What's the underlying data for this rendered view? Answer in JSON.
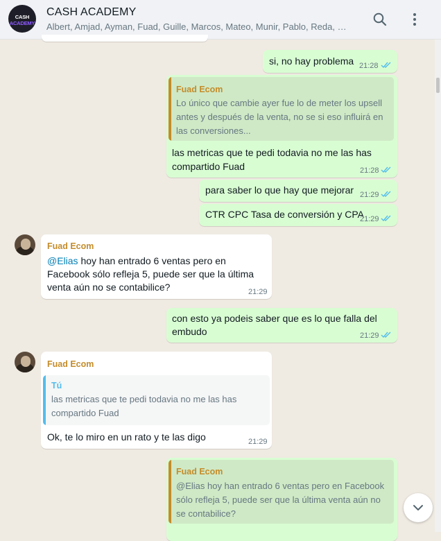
{
  "header": {
    "avatar_text_left": "CASH",
    "avatar_text_right": "ACADEMY",
    "title": "CASH ACADEMY",
    "members": "Albert, Amjad, Ayman, Fuad, Guille, Marcos, Mateo, Munir, Pablo, Reda, Vic...",
    "search_icon": "search-icon",
    "menu_icon": "more-vertical-icon"
  },
  "colors": {
    "outgoing": "#d9fdd3",
    "incoming": "#ffffff",
    "sender_name": "#c48c2a",
    "read_ticks": "#53bdeb",
    "mention": "#027eb5"
  },
  "messages": [
    {
      "text": "si, no hay problema",
      "time": "21:28"
    },
    {
      "quote_sender": "Fuad Ecom",
      "quote_lines": [
        "Lo único que cambie ayer fue lo de meter los upsell",
        "antes y después de la venta, no se si eso influirá en",
        "las conversiones..."
      ],
      "lines": [
        "las metricas que te pedi todavia no me las has",
        "compartido Fuad"
      ],
      "time": "21:28"
    },
    {
      "text": "para saber lo que hay que mejorar",
      "time": "21:29"
    },
    {
      "text": "CTR CPC Tasa de conversión y CPA",
      "time": "21:29"
    },
    {
      "sender": "Fuad Ecom",
      "mention": "@Elias",
      "line1_rest": " hoy han entrado 6 ventas pero en",
      "line2": "Facebook sólo refleja 5, puede ser que la última",
      "line3": "venta aún no se contabilice?",
      "time": "21:29"
    },
    {
      "lines": [
        "con esto ya podeis saber que es lo que falla del",
        "embudo"
      ],
      "time": "21:29"
    },
    {
      "sender": "Fuad Ecom",
      "quote_sender": "Tú",
      "quote_lines": [
        "las metricas que te pedi todavia no me las has",
        "compartido Fuad"
      ],
      "text": "Ok, te lo miro en un rato y te las digo",
      "time": "21:29"
    },
    {
      "quote_sender": "Fuad Ecom",
      "quote_lines": [
        "@Elias hoy han entrado 6 ventas pero en Facebook",
        "sólo refleja 5, puede ser que la última venta aún no",
        "se contabilice?"
      ]
    }
  ],
  "scroll_down_icon": "chevron-down-icon"
}
